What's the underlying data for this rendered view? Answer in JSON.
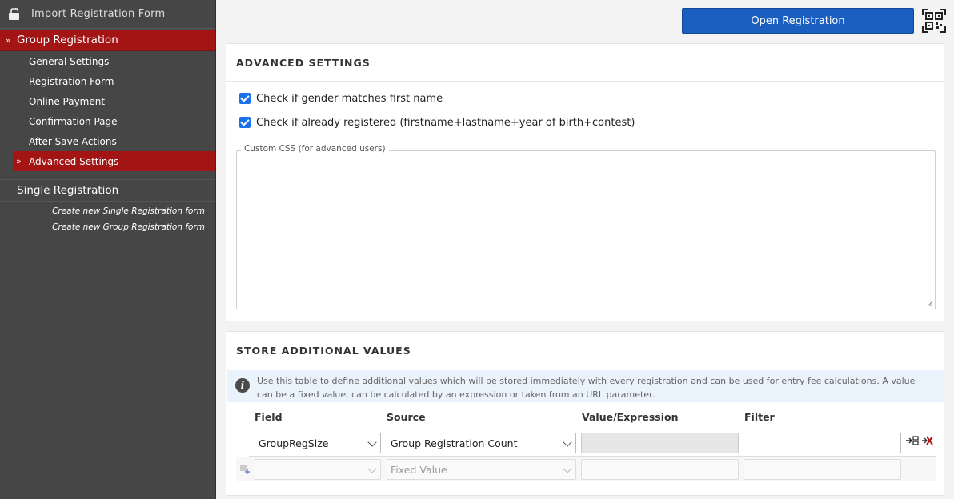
{
  "sidebar": {
    "import_label": "Import Registration Form",
    "group_label": "Group Registration",
    "group_items": [
      {
        "label": "General Settings"
      },
      {
        "label": "Registration Form"
      },
      {
        "label": "Online Payment"
      },
      {
        "label": "Confirmation Page"
      },
      {
        "label": "After Save Actions"
      },
      {
        "label": "Advanced Settings",
        "active": true
      }
    ],
    "single_label": "Single Registration",
    "create_single": "Create new Single Registration form",
    "create_group": "Create new Group Registration form",
    "raquo": "»"
  },
  "header": {
    "open_button": "Open Registration",
    "qr_icon": "qr-code-icon"
  },
  "advanced": {
    "title": "ADVANCED SETTINGS",
    "check1": "Check if gender matches first name",
    "check2": "Check if already registered (firstname+lastname+year of birth+contest)",
    "css_legend": "Custom CSS (for advanced users)"
  },
  "store": {
    "title": "STORE ADDITIONAL VALUES",
    "info": "Use this table to define additional values which will be stored immediately with every registration and can be used for entry fee calculations. A value can be a fixed value, can be calculated by an expression or taken from an URL parameter.",
    "columns": {
      "field": "Field",
      "source": "Source",
      "value": "Value/Expression",
      "filter": "Filter"
    },
    "rows": [
      {
        "field": "GroupRegSize",
        "source": "Group Registration Count",
        "value": "",
        "filter": ""
      },
      {
        "field": "",
        "source": "Fixed Value",
        "value": "",
        "filter": ""
      }
    ]
  },
  "colors": {
    "accent": "#a31515",
    "button": "#1a5fbf",
    "sidebar": "#464646"
  }
}
